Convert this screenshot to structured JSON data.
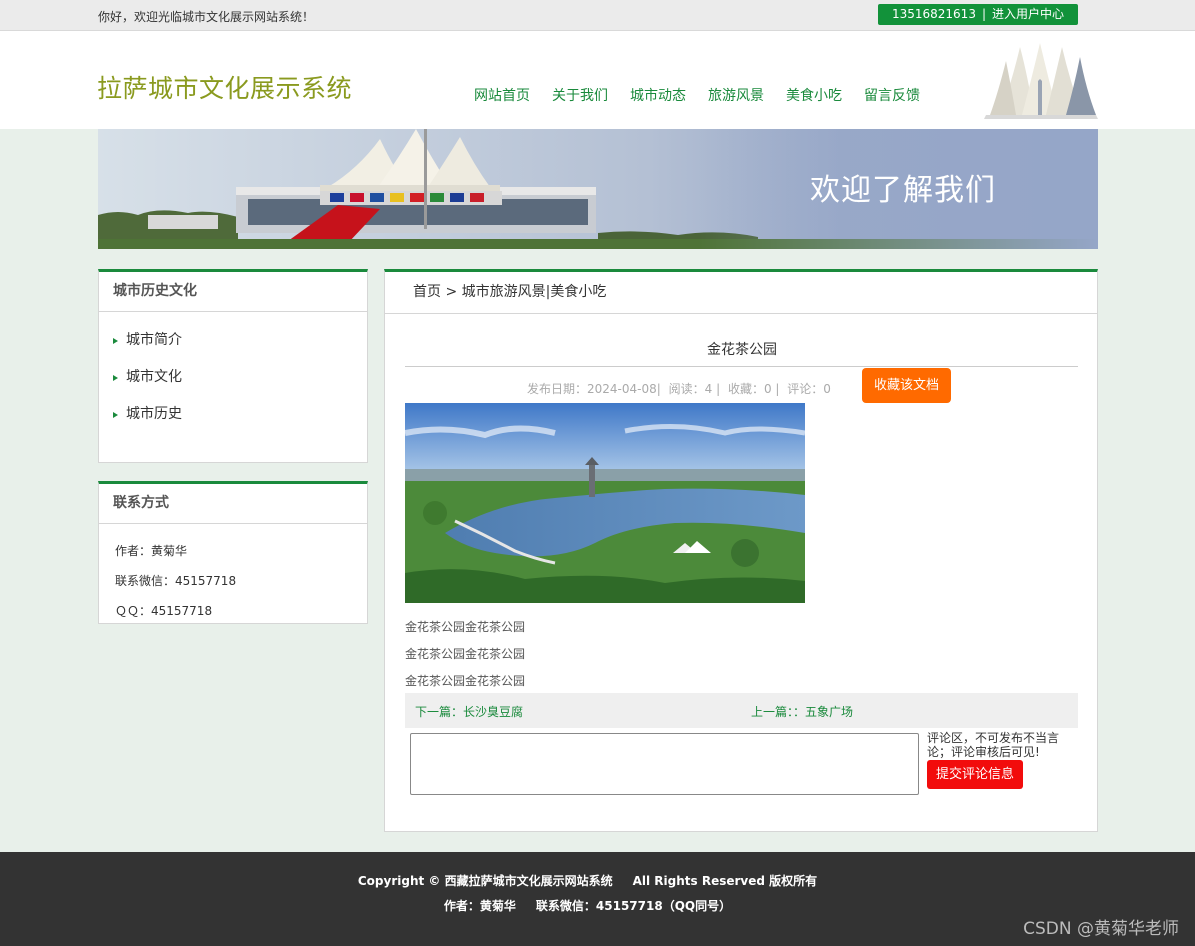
{
  "topbar": {
    "welcome": "你好，欢迎光临城市文化展示网站系统！",
    "phone": "13516821613",
    "separator": "|",
    "user_center": "进入用户中心"
  },
  "header": {
    "site_title": "拉萨城市文化展示系统",
    "nav": [
      "网站首页",
      "关于我们",
      "城市动态",
      "旅游风景",
      "美食小吃",
      "留言反馈"
    ]
  },
  "banner": {
    "welcome_text": "欢迎了解我们"
  },
  "sidebar": {
    "history_box": {
      "title": "城市历史文化",
      "items": [
        "城市简介",
        "城市文化",
        "城市历史"
      ]
    },
    "contact_box": {
      "title": "联系方式",
      "author": "作者：黄菊华",
      "wechat": "联系微信：45157718",
      "qq": "ＱＱ：45157718"
    }
  },
  "main": {
    "breadcrumb": "首页 > 城市旅游风景|美食小吃",
    "article_title": "金花茶公园",
    "meta": {
      "date": "发布日期：2024-04-08|",
      "reads": "阅读：4 |",
      "favorites": "收藏：0 |",
      "comments": "评论：0"
    },
    "favorite_button": "收藏该文档",
    "paragraphs": [
      "金花茶公园金花茶公园",
      "金花茶公园金花茶公园",
      "金花茶公园金花茶公园"
    ],
    "next": "下一篇：长沙臭豆腐",
    "prev": "上一篇：：五象广场",
    "comment_note": "评论区，不可发布不当言论；评论审核后可见!",
    "submit_button": "提交评论信息"
  },
  "footer": {
    "copyright": "Copyright © 西藏拉萨城市文化展示网站系统",
    "rights": "All Rights Reserved 版权所有",
    "author": "作者：黄菊华",
    "wechat": "联系微信：45157718（QQ同号）",
    "watermark": "CSDN @黄菊华老师"
  },
  "colors": {
    "accent_green": "#1a8a3c",
    "title_olive": "#8a9a1f",
    "favorite_orange": "#ff6a00",
    "submit_red": "#f20c0c",
    "footer_bg": "#333333"
  }
}
